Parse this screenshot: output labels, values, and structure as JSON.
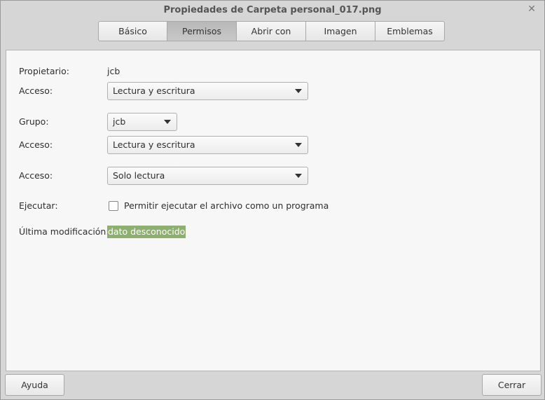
{
  "window": {
    "title": "Propiedades de Carpeta personal_017.png",
    "close": "✕"
  },
  "tabs": [
    {
      "label": "Básico"
    },
    {
      "label": "Permisos"
    },
    {
      "label": "Abrir con"
    },
    {
      "label": "Imagen"
    },
    {
      "label": "Emblemas"
    }
  ],
  "active_tab": "Permisos",
  "permissions": {
    "owner_label": "Propietario:",
    "owner_value": "jcb",
    "owner_access_label": "Acceso:",
    "owner_access_value": "Lectura y escritura",
    "group_label": "Grupo:",
    "group_value": "jcb",
    "group_access_label": "Acceso:",
    "group_access_value": "Lectura y escritura",
    "others_access_label": "Acceso:",
    "others_access_value": "Solo lectura",
    "execute_label": "Ejecutar:",
    "execute_checkbox_label": "Permitir ejecutar el archivo como un programa",
    "execute_checked": false,
    "modified_label": "Última modificación:",
    "modified_value": "dato desconocido"
  },
  "buttons": {
    "help": "Ayuda",
    "close": "Cerrar"
  },
  "colors": {
    "highlight": "#8db06e",
    "active_tab": "#bdbdbd"
  }
}
